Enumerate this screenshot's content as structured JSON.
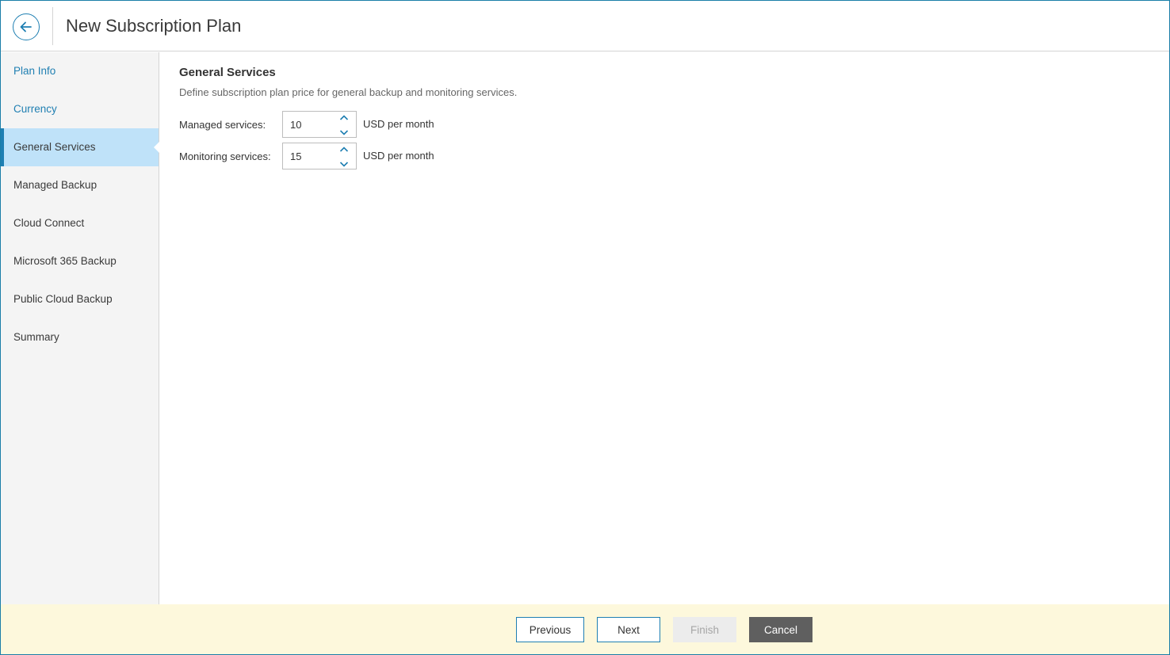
{
  "header": {
    "title": "New Subscription Plan",
    "back_icon": "arrow-left-icon"
  },
  "sidebar": {
    "items": [
      {
        "label": "Plan Info",
        "state": "link"
      },
      {
        "label": "Currency",
        "state": "link"
      },
      {
        "label": "General Services",
        "state": "active"
      },
      {
        "label": "Managed Backup",
        "state": "normal"
      },
      {
        "label": "Cloud Connect",
        "state": "normal"
      },
      {
        "label": "Microsoft 365 Backup",
        "state": "normal"
      },
      {
        "label": "Public Cloud Backup",
        "state": "normal"
      },
      {
        "label": "Summary",
        "state": "normal"
      }
    ]
  },
  "main": {
    "title": "General Services",
    "description": "Define subscription plan price for general backup and monitoring services.",
    "fields": [
      {
        "label": "Managed services:",
        "value": "10",
        "unit": "USD per month"
      },
      {
        "label": "Monitoring services:",
        "value": "15",
        "unit": "USD per month"
      }
    ]
  },
  "footer": {
    "previous_label": "Previous",
    "next_label": "Next",
    "finish_label": "Finish",
    "cancel_label": "Cancel"
  },
  "colors": {
    "accent": "#1f7fb2",
    "active_nav_bg": "#bfe2f9",
    "footer_bg": "#fdf8dc",
    "cancel_bg": "#5f5f5f"
  }
}
